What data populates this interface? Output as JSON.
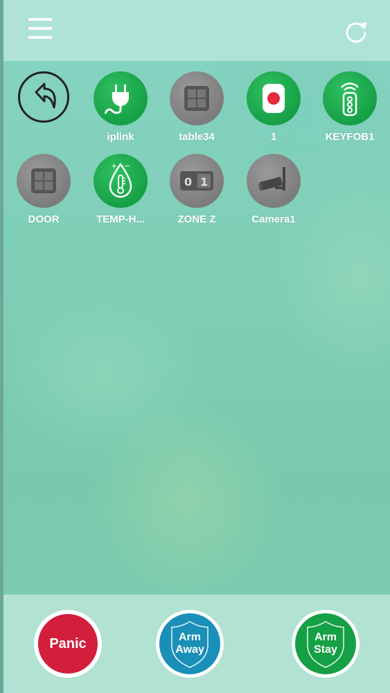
{
  "header": {
    "menu_icon": "hamburger-menu-icon",
    "refresh_icon": "refresh-icon"
  },
  "devices": [
    {
      "label": "",
      "icon": "back-arrow-icon",
      "style": "back"
    },
    {
      "label": "iplink",
      "icon": "power-plug-icon",
      "style": "green"
    },
    {
      "label": "table34",
      "icon": "window-sensor-icon",
      "style": "gray"
    },
    {
      "label": "1",
      "icon": "panic-button-icon",
      "style": "green"
    },
    {
      "label": "KEYFOB1",
      "icon": "keyfob-remote-icon",
      "style": "green"
    },
    {
      "label": "DOOR",
      "icon": "window-sensor-icon",
      "style": "gray"
    },
    {
      "label": "TEMP-H...",
      "icon": "thermometer-drop-icon",
      "style": "green"
    },
    {
      "label": "ZONE Z",
      "icon": "binary-switch-icon",
      "style": "gray"
    },
    {
      "label": "Camera1",
      "icon": "camera-icon",
      "style": "gray"
    }
  ],
  "actions": {
    "panic": {
      "label": "Panic",
      "color": "#d21f3c"
    },
    "arm_away": {
      "line1": "Arm",
      "line2": "Away",
      "color": "#1a8fb8"
    },
    "arm_stay": {
      "line1": "Arm",
      "line2": "Stay",
      "color": "#16a046"
    }
  }
}
